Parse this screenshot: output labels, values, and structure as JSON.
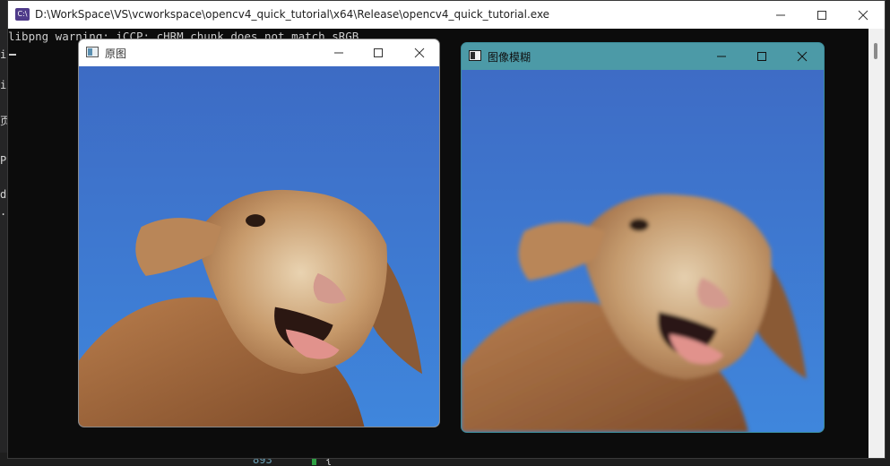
{
  "background": {
    "left_chars": [
      "i",
      "i",
      "页",
      "P",
      "d",
      "."
    ],
    "line_number": "893",
    "brace": "{"
  },
  "console": {
    "title": "D:\\WorkSpace\\VS\\vcworkspace\\opencv4_quick_tutorial\\x64\\Release\\opencv4_quick_tutorial.exe",
    "icon_text": "C:\\",
    "output": "libpng warning: iCCP: cHRM chunk does not match sRGB",
    "background": "#0c0c0c",
    "text_color": "#cccccc"
  },
  "windows": {
    "original": {
      "title": "原图",
      "content": "lamb-photo"
    },
    "blurred": {
      "title": "图像模糊",
      "content": "lamb-photo-blurred",
      "accent": "#4c9aa7"
    }
  },
  "icons": {
    "minimize": "minimize-icon",
    "maximize": "maximize-icon",
    "close": "close-icon"
  }
}
